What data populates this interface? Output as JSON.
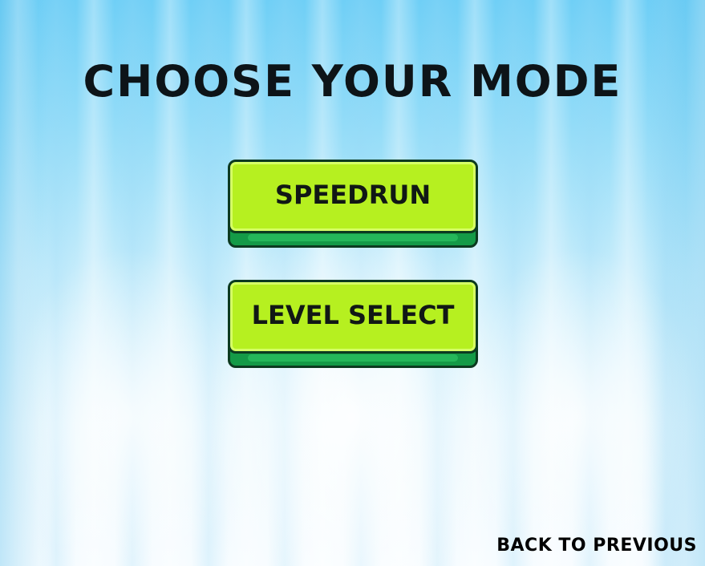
{
  "screen": {
    "title": "CHOOSE YOUR MODE"
  },
  "modes": [
    {
      "label": "SPEEDRUN"
    },
    {
      "label": "LEVEL SELECT"
    }
  ],
  "footer": {
    "back_label": "BACK TO PREVIOUS"
  },
  "colors": {
    "button_face": "#b6f020",
    "button_base": "#149a47",
    "button_outline": "#0c3a20",
    "text": "#0d1418",
    "sky_top": "#6fcff6",
    "sky_bottom": "#f7fcff"
  }
}
